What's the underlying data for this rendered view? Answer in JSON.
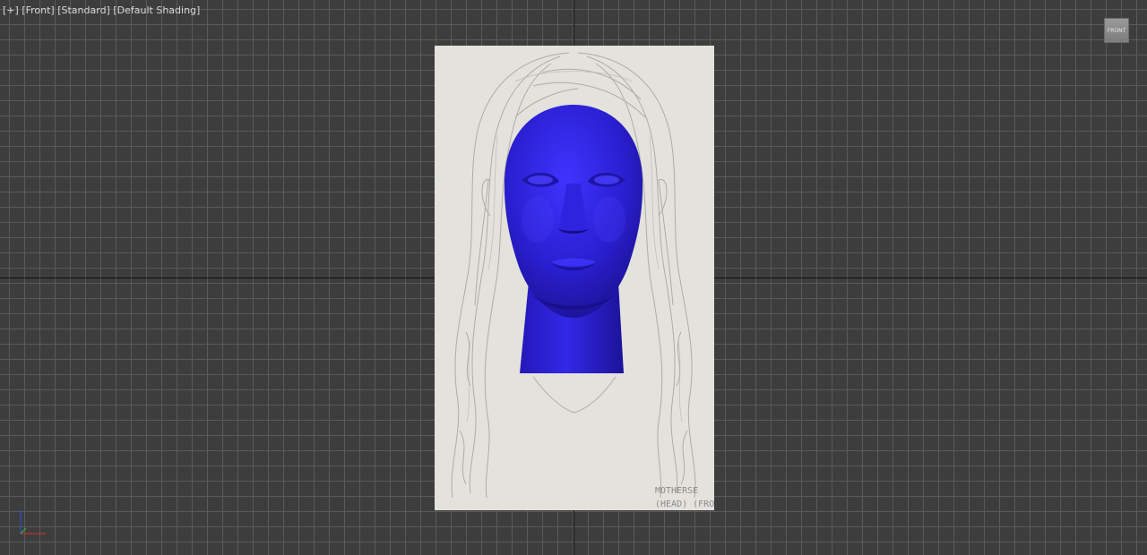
{
  "viewport": {
    "label_plus": "[+]",
    "label_view": "[Front]",
    "label_camera": "[Standard]",
    "label_shading": "[Default Shading]",
    "viewcube_face": "FRONT"
  },
  "reference_image": {
    "sketch_text_line1": "MOTHERSE",
    "sketch_text_line2": "(HEAD) (FRO"
  },
  "colors": {
    "viewport_bg": "#3d3d3d",
    "grid_line": "#5a5a5a",
    "model_color": "#2a1fd0",
    "reference_bg": "#e4e2dc"
  },
  "icons": {
    "viewcube": "viewcube-icon",
    "axis_gizmo": "axis-tripod-icon"
  }
}
